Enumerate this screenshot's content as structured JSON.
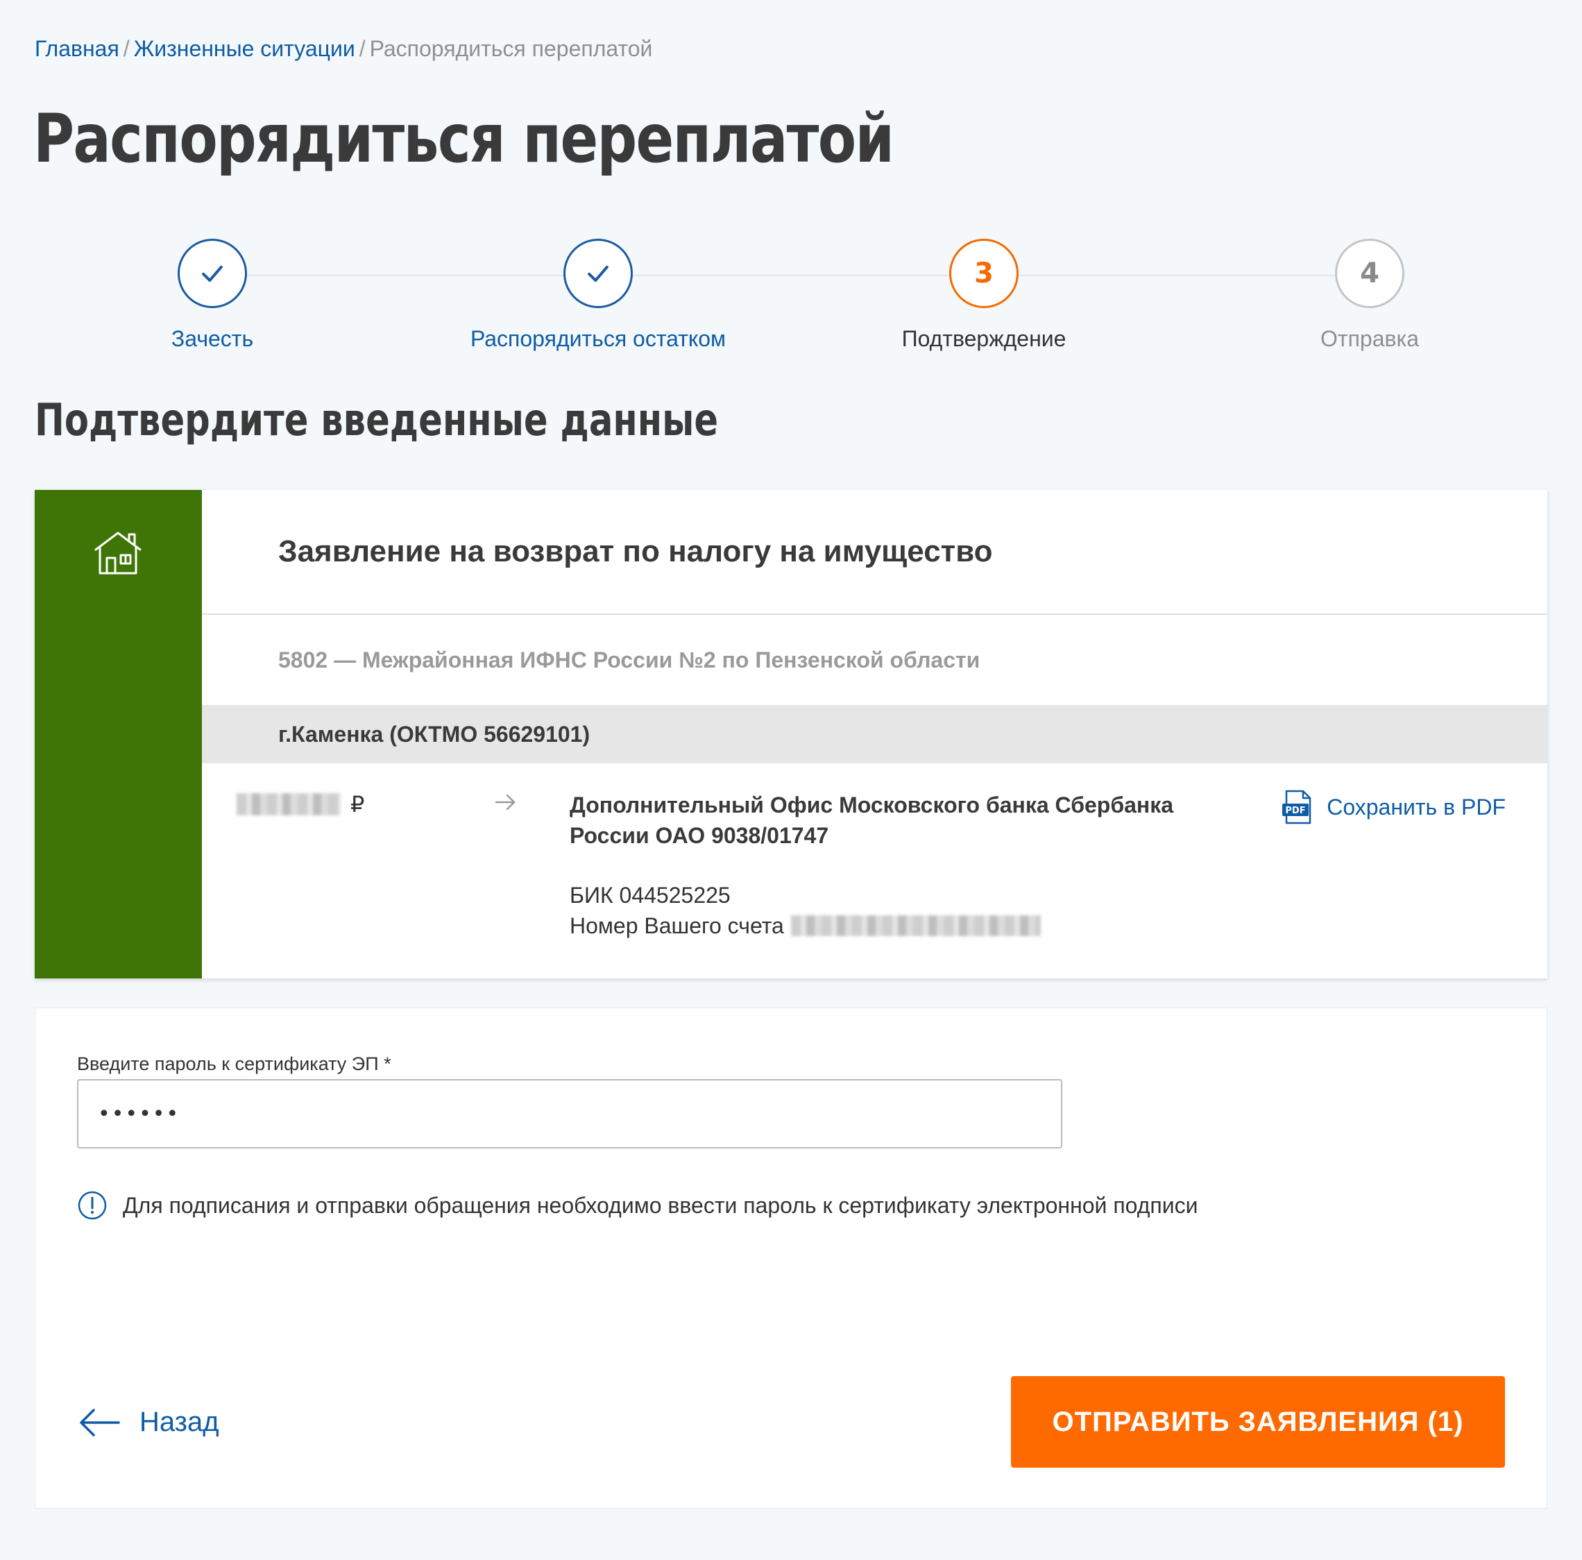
{
  "breadcrumb": {
    "home": "Главная",
    "sep1": "/",
    "situations": "Жизненные ситуации",
    "sep2": "/",
    "current": "Распорядиться переплатой"
  },
  "page_title": "Распорядиться переплатой",
  "stepper": {
    "steps": [
      {
        "label": "Зачесть",
        "status": "done",
        "icon": "check-icon"
      },
      {
        "label": "Распорядиться остатком",
        "status": "done",
        "icon": "check-icon"
      },
      {
        "label": "Подтверждение",
        "status": "active",
        "number": "3"
      },
      {
        "label": "Отправка",
        "status": "pending",
        "number": "4"
      }
    ]
  },
  "section_title": "Подтвердите введенные данные",
  "application": {
    "icon": "house-icon",
    "title": "Заявление на возврат по налогу на имущество",
    "ifns": "5802 — Межрайонная ИФНС России №2 по Пензенской области",
    "oktmo": "г.Каменка (ОКТМО 56629101)",
    "currency": "₽",
    "bank_name": "Дополнительный Офис Московского банка Сбербанка России ОАО 9038/01747",
    "bik": "БИК 044525225",
    "account_label": "Номер Вашего счета",
    "save_pdf": "Сохранить в PDF"
  },
  "signature": {
    "password_label": "Введите пароль к сертификату ЭП *",
    "password_value": "••••••",
    "hint": "Для подписания и отправки обращения необходимо ввести пароль к сертификату электронной подписи",
    "back": "Назад",
    "submit": "ОТПРАВИТЬ ЗАЯВЛЕНИЯ (1)"
  },
  "colors": {
    "link": "#0e5ca6",
    "accent": "#ff6a00",
    "stripe": "#3f7506",
    "background": "#f4f8fa"
  }
}
